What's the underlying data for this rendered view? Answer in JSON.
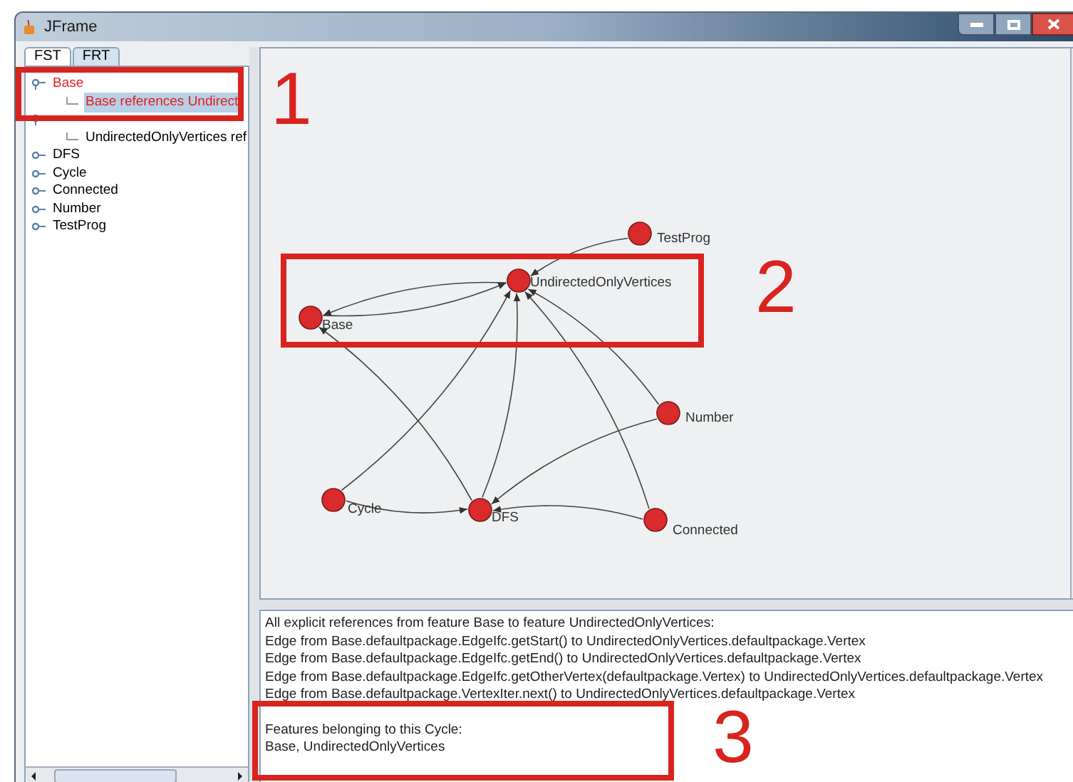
{
  "window": {
    "title": "JFrame"
  },
  "tabs": [
    {
      "label": "FST",
      "selected": true
    },
    {
      "label": "FRT",
      "selected": false
    }
  ],
  "tree": [
    {
      "label": "Base",
      "expanded": true,
      "marked": true,
      "selected": false,
      "children": [
        {
          "label": "Base references Undirect",
          "marked": true,
          "selected": true
        }
      ]
    },
    {
      "expanded": true,
      "children": [
        {
          "label": "UndirectedOnlyVertices ref",
          "marked": false,
          "selected": false
        }
      ]
    },
    {
      "label": "DFS",
      "expanded": false,
      "marked": false,
      "selected": false
    },
    {
      "label": "Cycle",
      "expanded": false,
      "marked": false,
      "selected": false
    },
    {
      "label": "Connected",
      "expanded": false,
      "marked": false,
      "selected": false
    },
    {
      "label": "Number",
      "expanded": false,
      "marked": false,
      "selected": false
    },
    {
      "label": "TestProg",
      "expanded": false,
      "marked": false,
      "selected": false
    }
  ],
  "graph": {
    "nodes": [
      "TestProg",
      "UndirectedOnlyVertices",
      "Base",
      "Number",
      "Cycle",
      "DFS",
      "Connected"
    ]
  },
  "details": {
    "lines": [
      "All explicit references from feature Base to feature UndirectedOnlyVertices:",
      "Edge from Base.defaultpackage.EdgeIfc.getStart() to UndirectedOnlyVertices.defaultpackage.Vertex",
      "Edge from Base.defaultpackage.EdgeIfc.getEnd() to UndirectedOnlyVertices.defaultpackage.Vertex",
      "Edge from Base.defaultpackage.EdgeIfc.getOtherVertex(defaultpackage.Vertex) to UndirectedOnlyVertices.defaultpackage.Vertex",
      "Edge from Base.defaultpackage.VertexIter.next() to UndirectedOnlyVertices.defaultpackage.Vertex"
    ],
    "cycle_heading": "Features belonging to this Cycle:",
    "cycle_features": "Base, UndirectedOnlyVertices"
  },
  "annotations": [
    "1",
    "2",
    "3"
  ]
}
